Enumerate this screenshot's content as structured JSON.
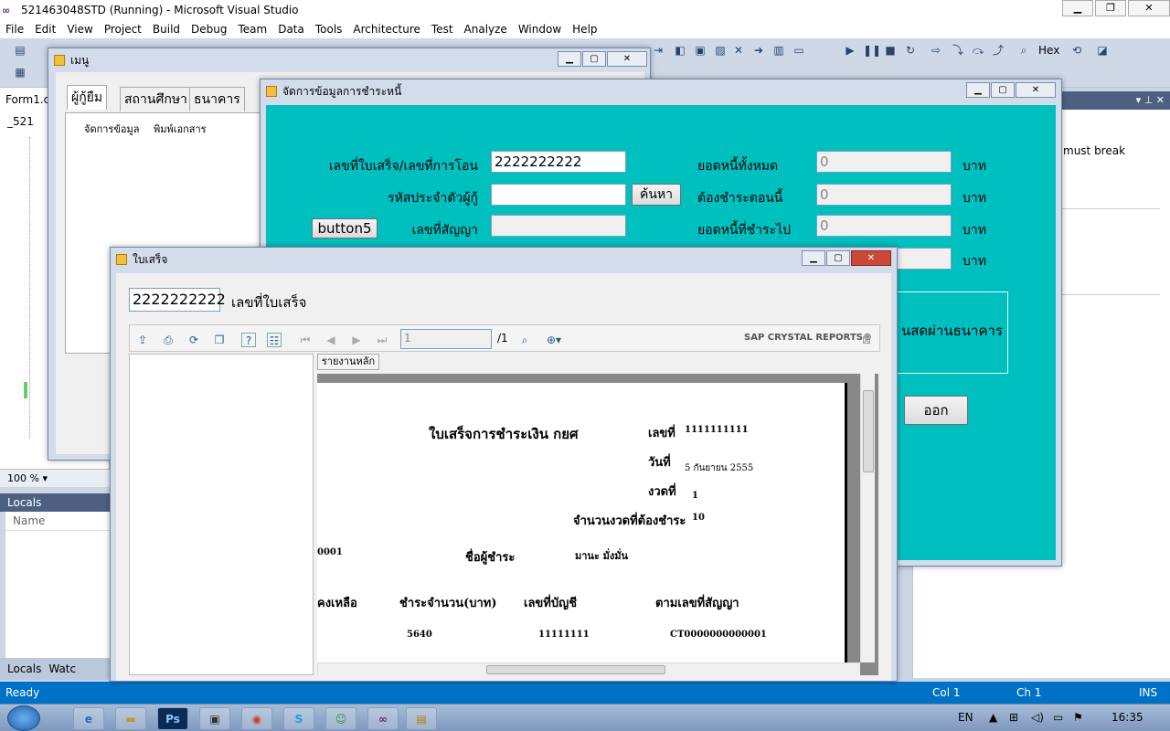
{
  "vs": {
    "title": "521463048STD (Running) - Microsoft Visual Studio",
    "menu": [
      "File",
      "Edit",
      "View",
      "Project",
      "Build",
      "Debug",
      "Team",
      "Data",
      "Tools",
      "Architecture",
      "Test",
      "Analyze",
      "Window",
      "Help"
    ],
    "hex_label": "Hex",
    "form_tab": "Form1.c",
    "solution_item": "_521",
    "zoom": "100 %",
    "locals_title": "Locals",
    "locals_col": "Name",
    "bottom_tabs": [
      "Locals",
      "Watc"
    ],
    "right_text": "must break",
    "status": {
      "ready": "Ready",
      "col": "Col 1",
      "ch": "Ch 1",
      "ins": "INS"
    }
  },
  "menu_form": {
    "title": "เมนู",
    "tabs": [
      "ผู้กู้ยืม",
      "สถานศึกษา",
      "ธนาคาร"
    ],
    "menu_items": [
      "จัดการข้อมูล",
      "พิมพ์เอกสาร"
    ]
  },
  "debt_form": {
    "title": "จัดการข้อมูลการชำระหนี้",
    "labels": {
      "receipt_no": "เลขที่ใบเสร็จ/เลขที่การโอน",
      "borrower_id": "รหัสประจำตัวผู้กู้",
      "contract_no": "เลขที่สัญญา",
      "total_debt": "ยอดหนี้ทั้งหมด",
      "pay_now": "ต้องชำระตอนนี้",
      "remaining": "ยอดหนี้ที่ชำระไป",
      "unit": "บาท"
    },
    "values": {
      "receipt_no": "2222222222",
      "borrower_id": "",
      "contract_no": "",
      "total_debt": "0",
      "pay_now": "0",
      "remaining": "0",
      "fourth": ""
    },
    "search_button": "ค้นหา",
    "button5": "button5",
    "group_text": "นสดผ่านธนาคาร",
    "exit_button": "ออก"
  },
  "receipt_form": {
    "title": "ใบเสร็จ",
    "receipt_value": "2222222222",
    "receipt_label": "เลขที่ใบเสร็จ",
    "viewer": {
      "page_value": "1",
      "page_total": "/1",
      "brand": "SAP CRYSTAL REPORTS®",
      "tab": "รายงานหลัก"
    },
    "report": {
      "heading": "ใบเสร็จการชำระเงิน กยศ",
      "no_label": "เลขที่",
      "no_value": "1111111111",
      "date_label": "วันที่",
      "date_value": "5 กันยายน 2555",
      "period_label": "งวดที่",
      "period_value": "1",
      "periods_due_label": "จำนวนงวดที่ต้องชำระ",
      "periods_due_value": "10",
      "left_code": "0001",
      "payer_label": "ชื่อผู้ชำระ",
      "payer_value": "มานะ มั่งมั่น",
      "col_remaining": "คงเหลือ",
      "col_amount": "ชำระจำนวน(บาท)",
      "col_account": "เลขที่บัญชี",
      "col_contract": "ตามเลขที่สัญญา",
      "amount": "5640",
      "account": "11111111",
      "contract": "CT0000000000001"
    }
  },
  "taskbar": {
    "lang": "EN",
    "time": "16:35"
  }
}
